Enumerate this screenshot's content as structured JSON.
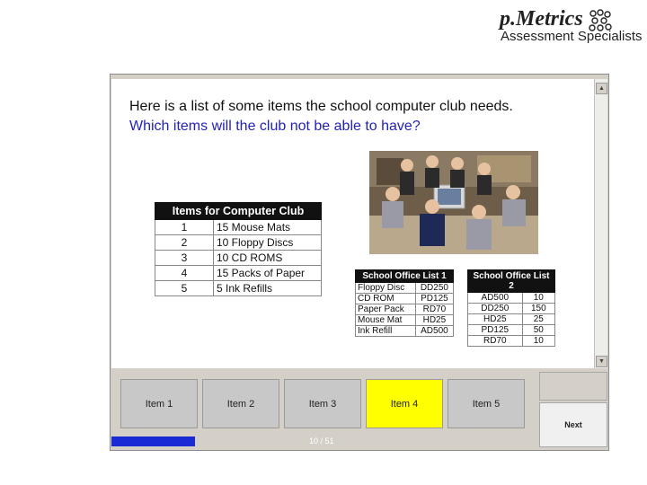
{
  "logo": {
    "wordmark": "p.Metrics",
    "tagline": "Assessment Specialists"
  },
  "question": {
    "line1": "Here is a list of some items the school computer club needs.",
    "line2": "Which items will the club not be able to have?"
  },
  "items_table": {
    "title": "Items for Computer Club",
    "rows": [
      {
        "num": "1",
        "item": "15 Mouse Mats"
      },
      {
        "num": "2",
        "item": "10 Floppy Discs"
      },
      {
        "num": "3",
        "item": "10 CD ROMS"
      },
      {
        "num": "4",
        "item": "15 Packs of Paper"
      },
      {
        "num": "5",
        "item": "5 Ink Refills"
      }
    ]
  },
  "office_list_1": {
    "title": "School Office List 1",
    "rows": [
      {
        "item": "Floppy Disc",
        "code": "DD250"
      },
      {
        "item": "CD ROM",
        "code": "PD125"
      },
      {
        "item": "Paper Pack",
        "code": "RD70"
      },
      {
        "item": "Mouse Mat",
        "code": "HD25"
      },
      {
        "item": "Ink Refill",
        "code": "AD500"
      }
    ]
  },
  "office_list_2": {
    "title": "School Office List 2",
    "rows": [
      {
        "code": "AD500",
        "qty": "10"
      },
      {
        "code": "DD250",
        "qty": "150"
      },
      {
        "code": "HD25",
        "qty": "25"
      },
      {
        "code": "PD125",
        "qty": "50"
      },
      {
        "code": "RD70",
        "qty": "10"
      }
    ]
  },
  "answer_buttons": [
    {
      "label": "Item 1",
      "selected": false
    },
    {
      "label": "Item 2",
      "selected": false
    },
    {
      "label": "Item 3",
      "selected": false
    },
    {
      "label": "Item 4",
      "selected": true
    },
    {
      "label": "Item 5",
      "selected": false
    }
  ],
  "navigation": {
    "next_label": "Next"
  },
  "status": {
    "counter": "10 / 51",
    "progress_fraction": 0.196
  },
  "colors": {
    "question_blue": "#2323b5",
    "selected_button": "#ffff00",
    "progress_bar": "#1a2bd6"
  }
}
